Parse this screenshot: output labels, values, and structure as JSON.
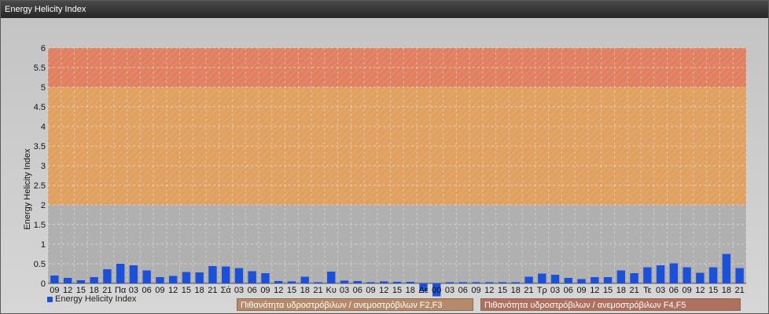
{
  "window": {
    "title": "Energy Helicity Index"
  },
  "colors": {
    "bar": "#1c50d8",
    "band_low": "#b0b0b0",
    "band_mid": "#e0a060",
    "band_high": "#e08060",
    "grid": "#f0f0f0"
  },
  "legend": {
    "label": "Energy Helicity Index"
  },
  "bands": [
    {
      "label": "Πιθανότητα υδροστρόβιλων / ανεμοστρόβιλων F2,F3",
      "from": 2,
      "to": 5
    },
    {
      "label": "Πιθανότητα υδροστρόβιλων / ανεμοστρόβιλων F4,F5",
      "from": 5,
      "to": 6
    }
  ],
  "chart_data": {
    "type": "bar",
    "title": "",
    "xlabel": "",
    "ylabel": "Energy Helicity Index",
    "ylim": [
      0,
      6
    ],
    "yticks": [
      "0",
      "0.5",
      "1",
      "1.5",
      "2",
      "2.5",
      "3",
      "3.5",
      "4",
      "4.5",
      "5",
      "5.5",
      "6"
    ],
    "grid": true,
    "legend_position": "bottom-left",
    "categories": [
      "09",
      "12",
      "15",
      "18",
      "21",
      "Πα",
      "03",
      "06",
      "09",
      "12",
      "15",
      "18",
      "21",
      "Σά",
      "03",
      "06",
      "09",
      "12",
      "15",
      "18",
      "21",
      "Κυ",
      "03",
      "06",
      "09",
      "12",
      "15",
      "18",
      "Δε",
      "00",
      "03",
      "06",
      "09",
      "12",
      "15",
      "18",
      "21",
      "Τρ",
      "03",
      "06",
      "09",
      "12",
      "15",
      "18",
      "21",
      "Τε",
      "03",
      "06",
      "09",
      "12",
      "15",
      "18",
      "21"
    ],
    "series": [
      {
        "name": "Energy Helicity Index",
        "values": [
          0.2,
          0.14,
          0.08,
          0.16,
          0.36,
          0.5,
          0.46,
          0.33,
          0.16,
          0.19,
          0.29,
          0.28,
          0.44,
          0.43,
          0.39,
          0.31,
          0.26,
          0.06,
          0.05,
          0.17,
          0.03,
          0.3,
          0.07,
          0.06,
          0.03,
          0.05,
          0.04,
          0.04,
          -0.2,
          -0.33,
          0.03,
          0.03,
          0.03,
          0.03,
          0.03,
          0.03,
          0.17,
          0.25,
          0.22,
          0.14,
          0.11,
          0.16,
          0.16,
          0.33,
          0.26,
          0.41,
          0.46,
          0.51,
          0.41,
          0.27,
          0.41,
          0.75,
          0.39
        ]
      }
    ]
  }
}
